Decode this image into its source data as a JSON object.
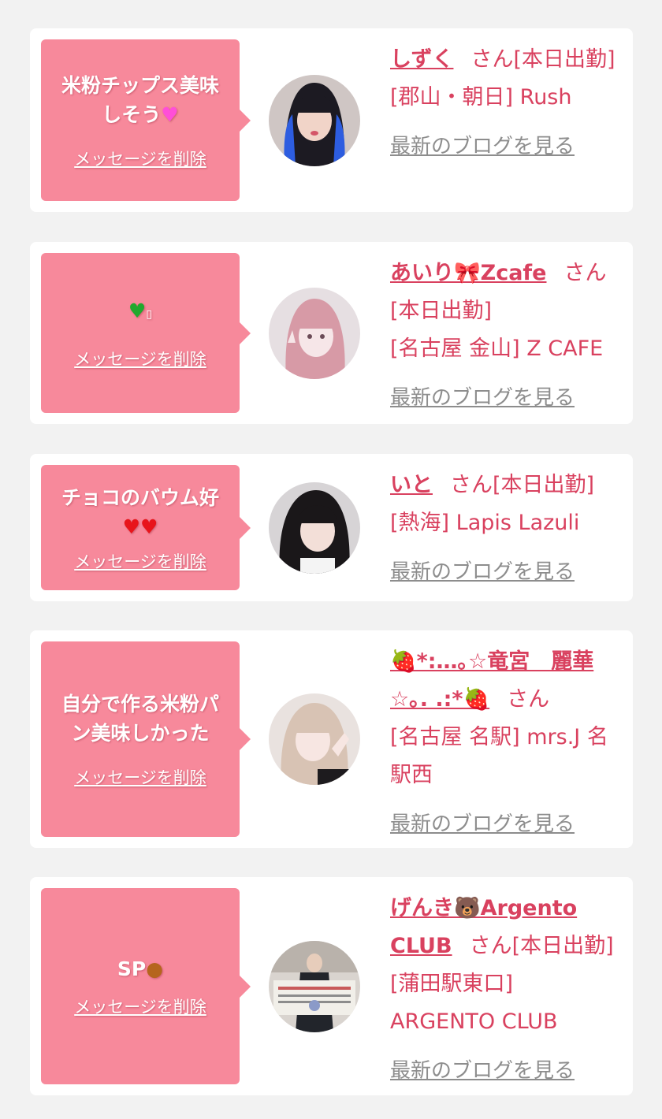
{
  "cards": [
    {
      "message": "米粉チップス美味しそう",
      "delete_label": "メッセージを削除",
      "name": "しずく",
      "honorific": "さん",
      "status": "[本日出勤]",
      "shop": "[郡山・朝日] Rush",
      "blog_label": "最新のブログを見る"
    },
    {
      "message": "",
      "delete_label": "メッセージを削除",
      "name": "あいり🎀Zcafe",
      "honorific": "さん",
      "status": "[本日出勤]",
      "shop": "[名古屋 金山] Z CAFE",
      "blog_label": "最新のブログを見る"
    },
    {
      "message": "チョコのバウム好",
      "delete_label": "メッセージを削除",
      "name": "いと",
      "honorific": "さん",
      "status": "[本日出勤]",
      "shop": "[熱海] Lapis Lazuli",
      "blog_label": "最新のブログを見る"
    },
    {
      "message": "自分で作る米粉パン美味しかった",
      "delete_label": "メッセージを削除",
      "name": "🍓*:…｡☆竜宮　麗華☆｡. .:*🍓",
      "honorific": "さん",
      "status": "",
      "shop": "[名古屋 名駅] mrs.J 名駅西",
      "blog_label": "最新のブログを見る"
    },
    {
      "message": "SP",
      "delete_label": "メッセージを削除",
      "name": "げんき🐻Argento CLUB",
      "honorific": "さん",
      "status": "[本日出勤]",
      "shop": "[蒲田駅東口] ARGENTO CLUB",
      "blog_label": "最新のブログを見る"
    }
  ],
  "colors": {
    "page_bg": "#f2f2f2",
    "bubble": "#f7899b",
    "name_text": "#d9415f",
    "link_gray": "#8d8d8d"
  },
  "icons": [
    "pink-heart-icon",
    "green-heart-icon",
    "red-heart-icon",
    "bear-icon",
    "ribbon-icon",
    "strawberry-icon"
  ]
}
